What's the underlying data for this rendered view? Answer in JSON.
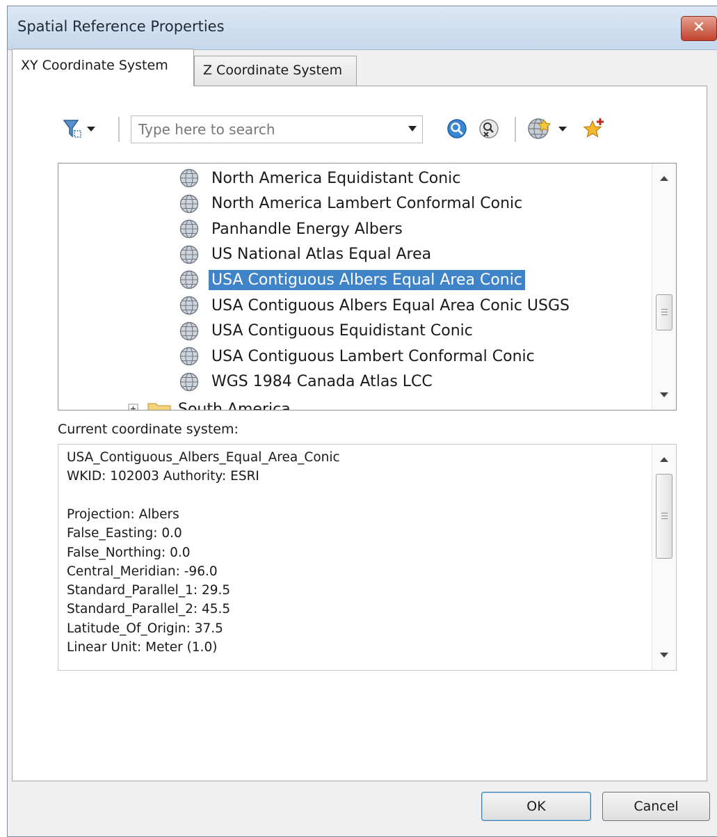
{
  "window": {
    "title": "Spatial Reference Properties",
    "close_glyph": "✕"
  },
  "tabs": [
    {
      "label": "XY Coordinate System",
      "active": true
    },
    {
      "label": "Z Coordinate System",
      "active": false
    }
  ],
  "toolbar": {
    "search_placeholder": "Type here to search",
    "icons": [
      "filter-icon",
      "dropdown-arrow-icon",
      "search-icon",
      "clear-search-icon",
      "globe-icon",
      "dropdown-arrow-icon",
      "add-favorite-icon"
    ]
  },
  "tree": {
    "items": [
      {
        "label": "North America Equidistant Conic",
        "selected": false
      },
      {
        "label": "North America Lambert Conformal Conic",
        "selected": false
      },
      {
        "label": "Panhandle Energy Albers",
        "selected": false
      },
      {
        "label": "US National Atlas Equal Area",
        "selected": false
      },
      {
        "label": "USA Contiguous Albers Equal Area Conic",
        "selected": true
      },
      {
        "label": "USA Contiguous Albers Equal Area Conic USGS",
        "selected": false
      },
      {
        "label": "USA Contiguous Equidistant Conic",
        "selected": false
      },
      {
        "label": "USA Contiguous Lambert Conformal Conic",
        "selected": false
      },
      {
        "label": "WGS 1984 Canada Atlas LCC",
        "selected": false
      }
    ],
    "folder": {
      "label": "South America",
      "expand_glyph": "+"
    }
  },
  "current": {
    "label": "Current coordinate system:",
    "lines": [
      "USA_Contiguous_Albers_Equal_Area_Conic",
      "WKID: 102003 Authority: ESRI",
      "",
      "Projection: Albers",
      "False_Easting: 0.0",
      "False_Northing: 0.0",
      "Central_Meridian: -96.0",
      "Standard_Parallel_1: 29.5",
      "Standard_Parallel_2: 45.5",
      "Latitude_Of_Origin: 37.5",
      "Linear Unit: Meter (1.0)"
    ]
  },
  "buttons": {
    "ok": "OK",
    "cancel": "Cancel"
  },
  "colors": {
    "selection": "#3f84c8",
    "titlebar": "#c6d8ec",
    "close": "#c0422e"
  }
}
